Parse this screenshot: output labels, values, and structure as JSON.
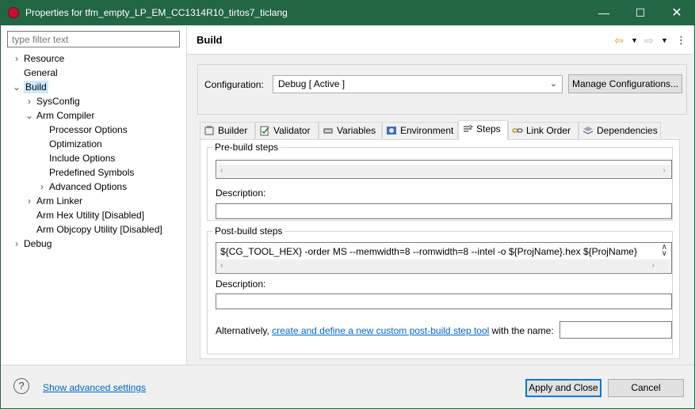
{
  "window": {
    "title": "Properties for tfm_empty_LP_EM_CC1314R10_tirtos7_ticlang"
  },
  "left": {
    "filter_placeholder": "type filter text",
    "tree": [
      {
        "label": "Resource"
      },
      {
        "label": "General"
      },
      {
        "label": "Build"
      },
      {
        "label": "SysConfig"
      },
      {
        "label": "Arm Compiler"
      },
      {
        "label": "Processor Options"
      },
      {
        "label": "Optimization"
      },
      {
        "label": "Include Options"
      },
      {
        "label": "Predefined Symbols"
      },
      {
        "label": "Advanced Options"
      },
      {
        "label": "Arm Linker"
      },
      {
        "label": "Arm Hex Utility  [Disabled]"
      },
      {
        "label": "Arm Objcopy Utility  [Disabled]"
      },
      {
        "label": "Debug"
      }
    ]
  },
  "page": {
    "title": "Build",
    "config_label": "Configuration:",
    "config_value": "Debug  [ Active ]",
    "manage_button": "Manage Configurations...",
    "tabs": [
      {
        "label": "Builder",
        "icon": "builder-icon"
      },
      {
        "label": "Validator",
        "icon": "validator-icon"
      },
      {
        "label": "Variables",
        "icon": "variables-icon"
      },
      {
        "label": "Environment",
        "icon": "environment-icon"
      },
      {
        "label": "Steps",
        "icon": "steps-icon"
      },
      {
        "label": "Link Order",
        "icon": "link-order-icon"
      },
      {
        "label": "Dependencies",
        "icon": "dependencies-icon"
      }
    ],
    "active_tab": "Steps",
    "pre_build": {
      "legend": "Pre-build steps",
      "command": "",
      "description_label": "Description:",
      "description": ""
    },
    "post_build": {
      "legend": "Post-build steps",
      "command": "${CG_TOOL_HEX} -order MS --memwidth=8 --romwidth=8 --intel -o ${ProjName}.hex ${ProjName}",
      "description_label": "Description:",
      "description": "",
      "alt_prefix": "Alternatively, ",
      "alt_link": "create and define a new custom post-build step tool",
      "alt_suffix": " with the name:",
      "tool_name": ""
    }
  },
  "bottom": {
    "help_glyph": "?",
    "advanced_link": "Show advanced settings",
    "apply_close": "Apply and Close",
    "cancel": "Cancel"
  },
  "colors": {
    "titlebar": "#226644",
    "link": "#0066cc",
    "selection": "#cce8ff",
    "brand_icon": "#c8102e"
  }
}
